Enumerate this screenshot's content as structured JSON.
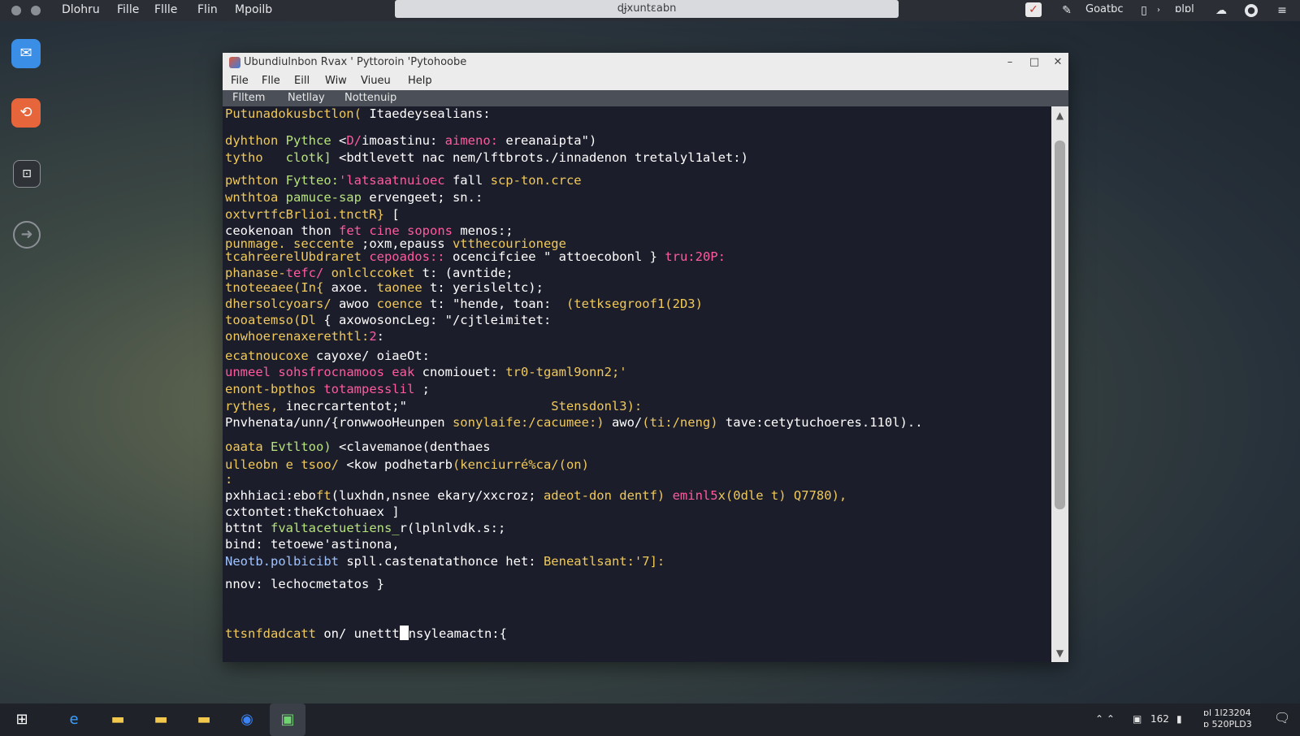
{
  "topbar": {
    "menus": [
      "Dlohru",
      "Fille",
      "Fllle",
      "Flin",
      "Mpoilb"
    ],
    "search_text": "ɖɉxuntεabn",
    "right_label": "Goatbc",
    "right_label2": "ɒlɒl",
    "icons": [
      "app-badge-icon",
      "edit-icon",
      "panel-icon",
      "chevron-icon",
      "cloud-icon",
      "user-icon",
      "menu-icon"
    ]
  },
  "dock": {
    "icons": [
      "chat-icon",
      "app-icon",
      "screenshot-icon",
      "update-icon"
    ]
  },
  "window": {
    "title": "Ubundiulnbon Rvax ' Pyttoroin 'Pytohoobe",
    "menus": [
      "File",
      "Flle",
      "Eill",
      "Wiw",
      "Viueu",
      "Help"
    ],
    "tabs": [
      "Flltem",
      "Netllay",
      "Nottenuip"
    ],
    "colors": {
      "background": "#1b1d2b",
      "yellow": "#f0c95a",
      "green": "#b6e37a",
      "pink": "#ff5aa0",
      "white": "#ffffff",
      "blue": "#9fc3ff"
    }
  },
  "terminal": {
    "lines": [
      [
        {
          "t": "Putunadokusbctlon( ",
          "c": "#f0c95a"
        },
        {
          "t": "Itaedeysealians:",
          "c": "#ffffff"
        }
      ],
      [
        {
          "t": "dyhthon ",
          "c": "#f0c95a"
        },
        {
          "t": "Pythce ",
          "c": "#b6e37a"
        },
        {
          "t": "<",
          "c": "#ffffff"
        },
        {
          "t": "D/",
          "c": "#ff5aa0"
        },
        {
          "t": "imoastinu: ",
          "c": "#ffffff"
        },
        {
          "t": "aimeno: ",
          "c": "#ff5aa0"
        },
        {
          "t": "ereanaipta\")",
          "c": "#ffffff"
        }
      ],
      [
        {
          "t": "tytho   ",
          "c": "#f0c95a"
        },
        {
          "t": "clotk] ",
          "c": "#b6e37a"
        },
        {
          "t": "<bdtlevett nac ",
          "c": "#ffffff"
        },
        {
          "t": "nem/lftbrots.",
          "c": "#ffffff"
        },
        {
          "t": "/innadenon tretalyl1alet:)",
          "c": "#ffffff"
        }
      ],
      [
        {
          "t": "pwthton ",
          "c": "#f0c95a"
        },
        {
          "t": "Fytteo:",
          "c": "#b6e37a"
        },
        {
          "t": "'latsaatnuioec ",
          "c": "#ff5aa0"
        },
        {
          "t": "fall ",
          "c": "#ffffff"
        },
        {
          "t": "scp-ton.crce",
          "c": "#f0c95a"
        }
      ],
      [
        {
          "t": "wnthtoa ",
          "c": "#f0c95a"
        },
        {
          "t": "pamuce-sap ",
          "c": "#b6e37a"
        },
        {
          "t": "ervengeet; ",
          "c": "#ffffff"
        },
        {
          "t": "sn.:",
          "c": "#ffffff"
        }
      ],
      [
        {
          "t": "oxtvrtfcBrlioi.tnctR} ",
          "c": "#f0c95a"
        },
        {
          "t": "[",
          "c": "#ffffff"
        }
      ],
      [
        {
          "t": "ceokenoan ",
          "c": "#ffffff"
        },
        {
          "t": "thon ",
          "c": "#ffffff"
        },
        {
          "t": "fet cine sopons ",
          "c": "#ff5aa0"
        },
        {
          "t": "menos:;",
          "c": "#ffffff"
        }
      ],
      [
        {
          "t": "punmage. seccente ",
          "c": "#f0c95a"
        },
        {
          "t": ";oxm,epauss ",
          "c": "#ffffff"
        },
        {
          "t": "vtthecourionege",
          "c": "#f0c95a"
        }
      ],
      [
        {
          "t": "tcahreerelUbdraret ",
          "c": "#f0c95a"
        },
        {
          "t": "cepoados:: ",
          "c": "#ff5aa0"
        },
        {
          "t": "ocencifciee \" ",
          "c": "#ffffff"
        },
        {
          "t": "attoecobonl } ",
          "c": "#ffffff"
        },
        {
          "t": "tru:20P:",
          "c": "#ff5aa0"
        }
      ],
      [
        {
          "t": "phanase-",
          "c": "#f0c95a"
        },
        {
          "t": "tefc/ ",
          "c": "#ff5aa0"
        },
        {
          "t": "onlclccoket ",
          "c": "#f0c95a"
        },
        {
          "t": "t: (avntide;",
          "c": "#ffffff"
        }
      ],
      [
        {
          "t": "tnoteeaee(In{ ",
          "c": "#f0c95a"
        },
        {
          "t": "axoe. ",
          "c": "#ffffff"
        },
        {
          "t": "taonee ",
          "c": "#f0c95a"
        },
        {
          "t": "t: yerisleltc);",
          "c": "#ffffff"
        }
      ],
      [
        {
          "t": "dhersolcyoars/ ",
          "c": "#f0c95a"
        },
        {
          "t": "awoo ",
          "c": "#ffffff"
        },
        {
          "t": "coence ",
          "c": "#f0c95a"
        },
        {
          "t": "t: \"hende, toan:  ",
          "c": "#ffffff"
        },
        {
          "t": "(tetksegroof1(2D3)",
          "c": "#f0c95a"
        }
      ],
      [
        {
          "t": "tooatemso(Dl ",
          "c": "#f0c95a"
        },
        {
          "t": "{ axowosoncLeg: ",
          "c": "#ffffff"
        },
        {
          "t": "\"/cjtleimitet:",
          "c": "#ffffff"
        }
      ],
      [
        {
          "t": "onwhoerenaxerethtl:",
          "c": "#f0c95a"
        },
        {
          "t": "2",
          "c": "#ff5aa0"
        },
        {
          "t": ":",
          "c": "#ffffff"
        }
      ],
      [
        {
          "t": "ecatnoucoxe ",
          "c": "#f0c95a"
        },
        {
          "t": "cayoxe/ oiaeOt:",
          "c": "#ffffff"
        }
      ],
      [
        {
          "t": "unmeel ",
          "c": "#ff5aa0"
        },
        {
          "t": "sohsfrocnamoos eak ",
          "c": "#ff5aa0"
        },
        {
          "t": "cnomiouet: ",
          "c": "#ffffff"
        },
        {
          "t": "tr0-tgaml9onn2;'",
          "c": "#f0c95a"
        }
      ],
      [
        {
          "t": "enont-bpthos ",
          "c": "#f0c95a"
        },
        {
          "t": "totampesslil ",
          "c": "#ff5aa0"
        },
        {
          "t": ";",
          "c": "#ffffff"
        }
      ],
      [
        {
          "t": "rythes, ",
          "c": "#f0c95a"
        },
        {
          "t": "inecrcartentot;\"",
          "c": "#ffffff"
        },
        {
          "t": "                   Stensdonl3):",
          "c": "#f0c95a"
        }
      ],
      [
        {
          "t": "Pnvhenata/unn/",
          "c": "#ffffff"
        },
        {
          "t": "{ronwwooHeunpen ",
          "c": "#ffffff"
        },
        {
          "t": "sonylaife:/cacumee:) ",
          "c": "#f0c95a"
        },
        {
          "t": "awo/",
          "c": "#ffffff"
        },
        {
          "t": "(ti:/neng) ",
          "c": "#f0c95a"
        },
        {
          "t": "tave:cetytuchoeres.110l)..",
          "c": "#ffffff"
        }
      ],
      [
        {
          "t": "oaata ",
          "c": "#f0c95a"
        },
        {
          "t": "Evtltoo) ",
          "c": "#b6e37a"
        },
        {
          "t": "<clavemanoe(denthaes",
          "c": "#ffffff"
        }
      ],
      [
        {
          "t": "ulleobn e tsoo/ ",
          "c": "#f0c95a"
        },
        {
          "t": "<kow podhetarb",
          "c": "#ffffff"
        },
        {
          "t": "(kenciurré%ca/(on)",
          "c": "#f0c95a"
        }
      ],
      [
        {
          "t": ":",
          "c": "#f0c95a"
        }
      ],
      [
        {
          "t": "pxhhiaci:ebo",
          "c": "#ffffff"
        },
        {
          "t": "ft",
          "c": "#f0c95a"
        },
        {
          "t": "(luxhdn,nsnee ekary/xxcroz; ",
          "c": "#ffffff"
        },
        {
          "t": "adeot-don dentf) ",
          "c": "#f0c95a"
        },
        {
          "t": "eminl5",
          "c": "#ff5aa0"
        },
        {
          "t": "x(0dle t) ",
          "c": "#f0c95a"
        },
        {
          "t": "Q7780),",
          "c": "#f0c95a"
        }
      ],
      [
        {
          "t": "cxtontet:theKctohuaex ",
          "c": "#ffffff"
        },
        {
          "t": "]",
          "c": "#ffffff"
        }
      ],
      [
        {
          "t": "bttnt ",
          "c": "#ffffff"
        },
        {
          "t": "fvaltacetuetiens_",
          "c": "#b6e37a"
        },
        {
          "t": "r(lplnlvdk.s:;",
          "c": "#ffffff"
        }
      ],
      [
        {
          "t": "bind: ",
          "c": "#ffffff"
        },
        {
          "t": "tetoewe'astinona,",
          "c": "#ffffff"
        }
      ],
      [
        {
          "t": "Neotb.polbicibt ",
          "c": "#9fc3ff"
        },
        {
          "t": "spll.castenatathonce ",
          "c": "#ffffff"
        },
        {
          "t": "het: ",
          "c": "#ffffff"
        },
        {
          "t": "Beneatlsant:'7]:",
          "c": "#f0c95a"
        }
      ],
      [
        {
          "t": "nnov: ",
          "c": "#ffffff"
        },
        {
          "t": "lechocmetatos }",
          "c": "#ffffff"
        }
      ],
      [
        {
          "t": "ttsnfdadcatt ",
          "c": "#f0c95a"
        },
        {
          "t": "on/ unettt",
          "c": "#ffffff"
        }
      ]
    ],
    "prompt_tail": "nsyleamactn:{"
  },
  "taskbar": {
    "icons": [
      "windows-start-icon",
      "edge-browser-icon",
      "file-explorer-icon",
      "folder-icon",
      "folder2-icon",
      "app-blue-icon",
      "green-app-icon"
    ],
    "tray_text": "162",
    "clock_line1": "ɒl 1l23204",
    "clock_line2": "ɒ 520PLD3"
  }
}
